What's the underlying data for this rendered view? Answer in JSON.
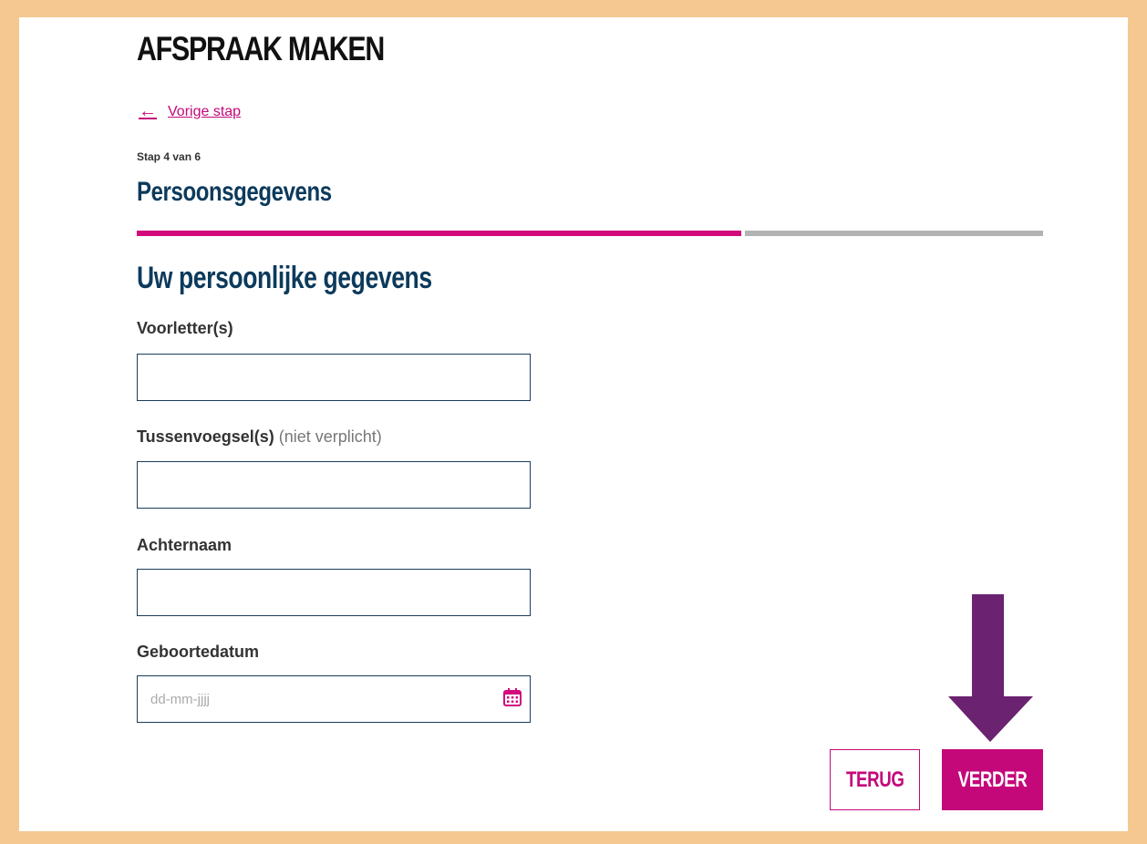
{
  "header": {
    "title": "AFSPRAAK MAKEN"
  },
  "nav": {
    "back_link": "Vorige stap"
  },
  "step": {
    "indicator": "Stap 4 van 6",
    "name": "Persoonsgegevens",
    "current": 4,
    "total": 6,
    "progress_fraction": 0.667
  },
  "form": {
    "title": "Uw persoonlijke gegevens",
    "fields": {
      "initials": {
        "label": "Voorletter(s)",
        "value": ""
      },
      "infix": {
        "label": "Tussenvoegsel(s)",
        "optional": "(niet verplicht)",
        "value": ""
      },
      "last_name": {
        "label": "Achternaam",
        "value": ""
      },
      "birth_date": {
        "label": "Geboortedatum",
        "placeholder": "dd-mm-jjjj",
        "value": ""
      }
    }
  },
  "buttons": {
    "back": "TERUG",
    "next": "VERDER"
  },
  "icons": {
    "back_arrow": "arrow-left-icon",
    "calendar": "calendar-icon",
    "annotation": "down-arrow-annotation"
  },
  "colors": {
    "accent": "#c4087a",
    "heading": "#0c3a5c",
    "progress_track": "#b3b3b3",
    "annotation_arrow": "#6b2270",
    "frame": "#f4c890"
  }
}
